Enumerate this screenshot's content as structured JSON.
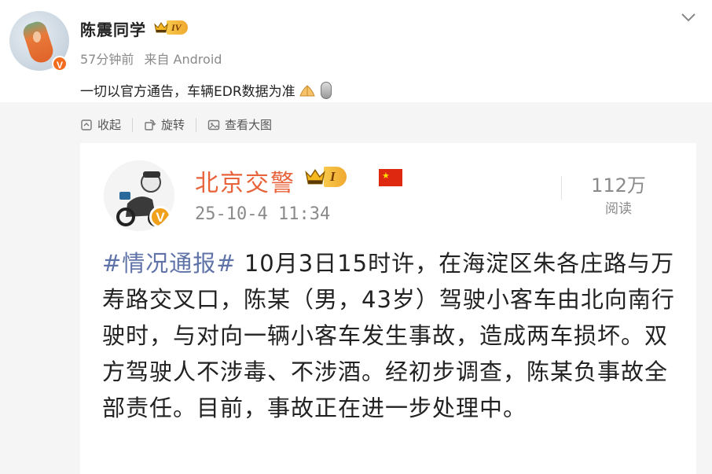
{
  "post": {
    "username": "陈震同学",
    "level": "IV",
    "time": "57分钟前",
    "source": "来自 Android",
    "text": "一切以官方通告，车辆EDR数据为准"
  },
  "actions": {
    "collapse": "收起",
    "rotate": "旋转",
    "view_large": "查看大图"
  },
  "card": {
    "username": "北京交警",
    "level": "I",
    "time": "25-10-4 11:34",
    "reads_num": "112万",
    "reads_label": "阅读",
    "hashtag": "#情况通报#",
    "body": " 10月3日15时许，在海淀区朱各庄路与万寿路交叉口，陈某（男，43岁）驾驶小客车由北向南行驶时，与对向一辆小客车发生事故，造成两车损坏。双方驾驶人不涉毒、不涉酒。经初步调查，陈某负事故全部责任。目前，事故正在进一步处理中。"
  },
  "icons": {
    "verified": "V",
    "flag_star": "★"
  },
  "colors": {
    "accent_orange": "#e8623a",
    "hashtag_blue": "#5f73a8",
    "badge_gold": "#f0a830"
  }
}
